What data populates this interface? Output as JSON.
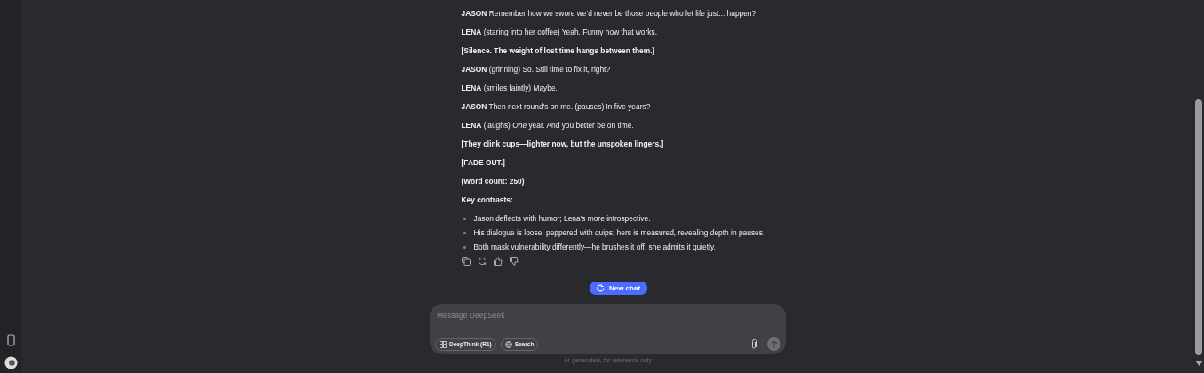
{
  "script": [
    {
      "kind": "dialogue",
      "speaker": "JASON",
      "text": "Remember how we swore we'd never be those people who let life just... happen?"
    },
    {
      "kind": "dialogue",
      "speaker": "LENA",
      "text": "(staring into her coffee) Yeah. Funny how that works."
    },
    {
      "kind": "direction",
      "text": "[Silence. The weight of lost time hangs between them.]"
    },
    {
      "kind": "dialogue",
      "speaker": "JASON",
      "text": "(grinning) So. Still time to fix it, right?"
    },
    {
      "kind": "dialogue",
      "speaker": "LENA",
      "text": "(smiles faintly) Maybe."
    },
    {
      "kind": "dialogue",
      "speaker": "JASON",
      "text": "Then next round's on me. (pauses) In five years?"
    },
    {
      "kind": "dialogue",
      "speaker": "LENA",
      "text": "(laughs) *One* year. And you better be on time."
    },
    {
      "kind": "direction",
      "text": "[They clink cups—lighter now, but the unspoken lingers.]"
    },
    {
      "kind": "direction",
      "text": "[FADE OUT.]"
    },
    {
      "kind": "direction",
      "text": "(Word count: 250)"
    },
    {
      "kind": "direction",
      "text": "Key contrasts:"
    }
  ],
  "bullets": [
    "Jason deflects with humor; Lena's more introspective.",
    "His dialogue is loose, peppered with quips; hers is measured, revealing depth in pauses.",
    "Both mask vulnerability differently—he brushes it off, she admits it quietly."
  ],
  "new_chat": "New chat",
  "composer": {
    "placeholder": "Message DeepSeek",
    "toggles": [
      {
        "label": "DeepThink (R1)",
        "kind": "think",
        "selected": false
      },
      {
        "label": "Search",
        "kind": "search",
        "selected": false
      }
    ],
    "send_disabled": true
  },
  "footer": "AI-generated, for reference only"
}
